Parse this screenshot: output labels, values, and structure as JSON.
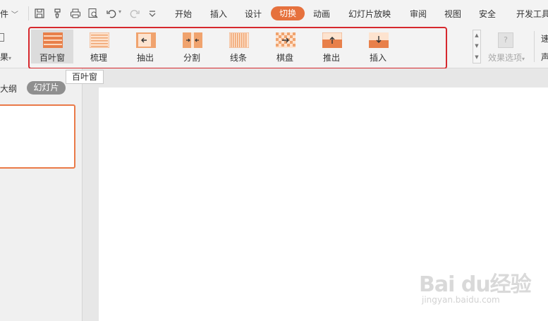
{
  "topbar": {
    "file_menu": "件",
    "menus": [
      "开始",
      "插入",
      "设计",
      "切换",
      "动画",
      "幻灯片放映",
      "审阅",
      "视图",
      "安全",
      "开发工具"
    ],
    "active_tab": "切换",
    "quick_icons": [
      "save-icon",
      "format-painter-icon",
      "print-icon",
      "print-preview-icon",
      "undo-icon",
      "redo-icon",
      "customize-icon"
    ]
  },
  "ribbon": {
    "left_stub_label": "果",
    "transitions": [
      {
        "label": "百叶窗",
        "icon": "blinds-icon"
      },
      {
        "label": "梳理",
        "icon": "comb-icon"
      },
      {
        "label": "抽出",
        "icon": "pull-out-icon"
      },
      {
        "label": "分割",
        "icon": "split-icon"
      },
      {
        "label": "线条",
        "icon": "lines-icon"
      },
      {
        "label": "棋盘",
        "icon": "checkerboard-icon"
      },
      {
        "label": "推出",
        "icon": "push-icon"
      },
      {
        "label": "插入",
        "icon": "insert-icon"
      }
    ],
    "selected": "百叶窗",
    "effect_options_label": "效果选项",
    "right_cut_1": "速",
    "right_cut_2": "声"
  },
  "tooltip": "百叶窗",
  "left_pane": {
    "outline_tab": "大纲",
    "slides_tab": "幻灯片"
  },
  "watermark": {
    "logo": "Bai du经验",
    "url": "jingyan.baidu.com"
  },
  "colors": {
    "accent": "#e6713d",
    "highlight": "#d6282d",
    "thumb_orange": "#f0a36e",
    "thumb_dark": "#e0763a"
  }
}
